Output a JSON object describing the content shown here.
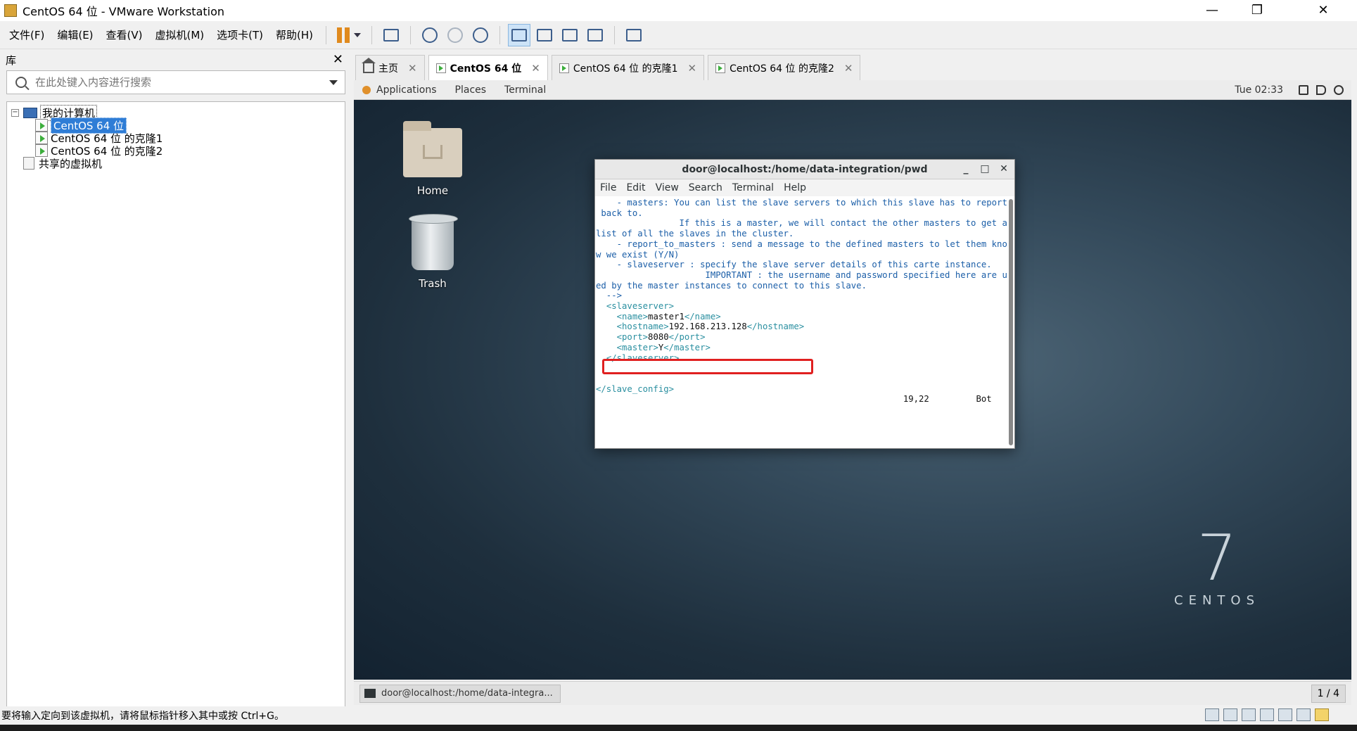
{
  "window": {
    "title": "CentOS 64 位 - VMware Workstation"
  },
  "menu": [
    "文件(F)",
    "编辑(E)",
    "查看(V)",
    "虚拟机(M)",
    "选项卡(T)",
    "帮助(H)"
  ],
  "library": {
    "title": "库",
    "search_placeholder": "在此处键入内容进行搜索",
    "tree": {
      "root": "我的计算机",
      "vms": [
        "CentOS 64 位",
        "CentOS 64 位 的克隆1",
        "CentOS 64 位 的克隆2"
      ],
      "shared": "共享的虚拟机"
    }
  },
  "tabs": [
    {
      "label": "主页",
      "icon": "home-icon"
    },
    {
      "label": "CentOS 64 位",
      "icon": "vm-icon",
      "active": true
    },
    {
      "label": "CentOS 64 位 的克隆1",
      "icon": "vm-icon"
    },
    {
      "label": "CentOS 64 位 的克隆2",
      "icon": "vm-icon"
    }
  ],
  "gnome": {
    "applications": "Applications",
    "places": "Places",
    "terminal": "Terminal",
    "clock": "Tue 02:33"
  },
  "desktop": {
    "home_label": "Home",
    "trash_label": "Trash",
    "logo_number": "7",
    "logo_word": "CENTOS"
  },
  "terminal_window": {
    "title": "door@localhost:/home/data-integration/pwd",
    "menu": [
      "File",
      "Edit",
      "View",
      "Search",
      "Terminal",
      "Help"
    ],
    "lines": [
      "    - masters: You can list the slave servers to which this slave has to report",
      " back to.",
      "                If this is a master, we will contact the other masters to get a",
      "list of all the slaves in the cluster.",
      "",
      "    - report_to_masters : send a message to the defined masters to let them kno",
      "w we exist (Y/N)",
      "",
      "    - slaveserver : specify the slave server details of this carte instance.",
      "                     IMPORTANT : the username and password specified here are us",
      "ed by the master instances to connect to this slave.",
      "",
      "  -->",
      ""
    ],
    "xml": {
      "slaveserver_open": "<slaveserver>",
      "name_open": "<name>",
      "name_value": "master1",
      "name_close": "</name>",
      "hostname_open": "<hostname>",
      "hostname_value": "192.168.213.128",
      "hostname_close": "</hostname>",
      "port_open": "<port>",
      "port_value": "8080",
      "port_close": "</port>",
      "master_open": "<master>",
      "master_value": "Y",
      "master_close": "</master>",
      "slaveserver_close": "</slaveserver>",
      "config_close": "</slave_config>"
    },
    "status_pos": "19,22",
    "status_scroll": "Bot"
  },
  "vm_taskbar": {
    "item": "door@localhost:/home/data-integra...",
    "page": "1 / 4"
  },
  "statusbar": {
    "text": "要将输入定向到该虚拟机，请将鼠标指针移入其中或按 Ctrl+G。"
  },
  "colors": {
    "selection": "#2f7dd6",
    "highlight_box": "#e02020",
    "terminal_text": "#1c5fa8",
    "xml_tag": "#2a8fa0"
  }
}
